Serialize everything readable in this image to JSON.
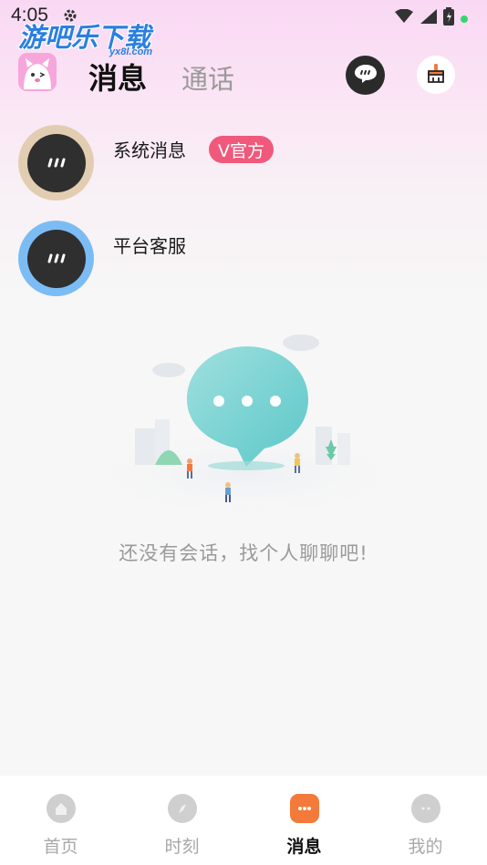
{
  "status_bar": {
    "time": "4:05",
    "icons": [
      "gear-icon",
      "wifi-icon",
      "signal-icon",
      "battery-icon",
      "dot-icon"
    ]
  },
  "watermark": {
    "text": "游吧乐下载",
    "sub": "yx8l.com"
  },
  "header": {
    "tabs": [
      {
        "label": "消息",
        "active": true
      },
      {
        "label": "通话",
        "active": false
      }
    ],
    "actions": [
      "chat-bubble-icon",
      "broom-icon"
    ]
  },
  "conversations": [
    {
      "title": "系统消息",
      "badge": "V官方",
      "avatar_color": "#e3cdb2"
    },
    {
      "title": "平台客服",
      "badge": "",
      "avatar_color": "#7cbcf4"
    }
  ],
  "empty_state": {
    "text": "还没有会话，找个人聊聊吧!"
  },
  "bottom_nav": [
    {
      "label": "首页",
      "icon": "home-icon",
      "active": false
    },
    {
      "label": "时刻",
      "icon": "compass-icon",
      "active": false
    },
    {
      "label": "消息",
      "icon": "message-icon",
      "active": true
    },
    {
      "label": "我的",
      "icon": "profile-icon",
      "active": false
    }
  ],
  "colors": {
    "accent": "#f37a3a",
    "badge": "#f0597b",
    "header_gradient": "#f9d8f3"
  }
}
